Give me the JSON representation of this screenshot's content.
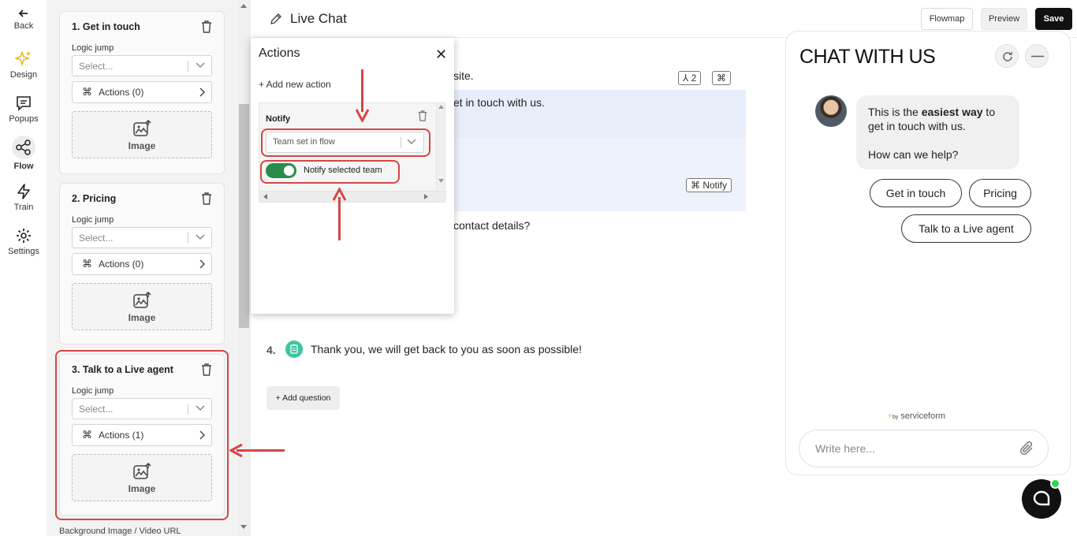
{
  "rail": {
    "back": "Back",
    "items": [
      {
        "label": "Design",
        "icon": "sparkles-icon"
      },
      {
        "label": "Popups",
        "icon": "chat-square-icon"
      },
      {
        "label": "Flow",
        "icon": "share-nodes-icon"
      },
      {
        "label": "Train",
        "icon": "lightning-icon"
      },
      {
        "label": "Settings",
        "icon": "gear-icon"
      }
    ],
    "active": "Flow"
  },
  "questions": [
    {
      "title": "1. Get in touch",
      "logic_label": "Logic jump",
      "select_placeholder": "Select...",
      "actions": "Actions (0)",
      "image": "Image"
    },
    {
      "title": "2. Pricing",
      "logic_label": "Logic jump",
      "select_placeholder": "Select...",
      "actions": "Actions (0)",
      "image": "Image"
    },
    {
      "title": "3. Talk to a Live agent",
      "logic_label": "Logic jump",
      "select_placeholder": "Select...",
      "actions": "Actions (1)",
      "image": "Image"
    }
  ],
  "background_label": "Background Image / Video URL",
  "topbar": {
    "title": "Live Chat",
    "flowmap": "Flowmap",
    "preview": "Preview",
    "save": "Save"
  },
  "canvas": {
    "line1": "site.",
    "line2": "et in touch with us.",
    "line3": "contact details?",
    "tag_branch": "2",
    "tag_notify": "⌘ Notify",
    "q4_num": "4.",
    "q4_text": "Thank you, we will get back to you as soon as possible!",
    "add_question": "+ Add question"
  },
  "actions_modal": {
    "title": "Actions",
    "add_new": "+ Add new action",
    "notify_title": "Notify",
    "team_select": "Team set in flow",
    "toggle_label": "Notify selected team",
    "toggle_on": true
  },
  "chat": {
    "title": "CHAT WITH US",
    "msg_pre": "This is the ",
    "msg_bold": "easiest way",
    "msg_post": " to get in touch with us.",
    "msg_2": "How can we help?",
    "options": [
      "Get in touch",
      "Pricing",
      "Talk to a Live agent"
    ],
    "powered_by": "by",
    "brand": "serviceform",
    "input_placeholder": "Write here..."
  },
  "colors": {
    "accent_red": "#d64545",
    "toggle_green": "#2a8c4a",
    "online_dot": "#2bd94f",
    "clip_teal": "#3cc5a0"
  }
}
